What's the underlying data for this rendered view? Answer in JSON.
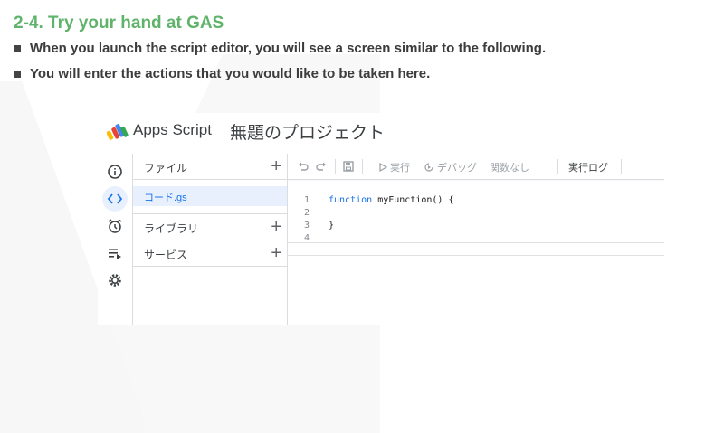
{
  "slide": {
    "title": "2-4. Try your hand at GAS",
    "bullets": [
      "When you launch the script editor, you will see a screen similar to the following.",
      "You will enter the actions that you would like to be taken here."
    ]
  },
  "editor": {
    "app_name": "Apps Script",
    "project_name": "無題のプロジェクト",
    "files_header": "ファイル",
    "file_name": "コード.gs",
    "libraries_label": "ライブラリ",
    "services_label": "サービス",
    "toolbar": {
      "run": "実行",
      "debug": "デバッグ",
      "function_select": "関数なし",
      "execution_log": "実行ログ"
    },
    "line_numbers": [
      "1",
      "2",
      "3",
      "4"
    ],
    "code": {
      "keyword": "function",
      "signature": " myFunction() {",
      "close": "}"
    },
    "rail_icons": [
      "info-icon",
      "code-icon",
      "alarm-icon",
      "playlist-icon",
      "gear-icon"
    ]
  },
  "colors": {
    "title": "#5fb36a",
    "accent": "#1a73e8",
    "selected_bg": "#e8f0fe"
  }
}
